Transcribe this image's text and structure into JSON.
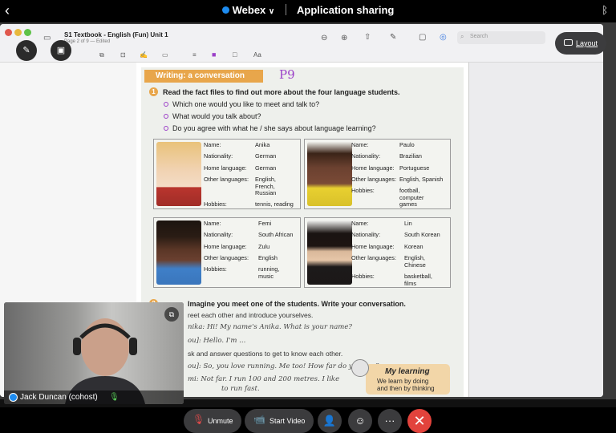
{
  "status_bar": {
    "app_name": "Webex",
    "chevron": "∨",
    "mode": "Application sharing",
    "back_glyph": "‹",
    "bluetooth_glyph": "ᛒ"
  },
  "shared_app": {
    "doc_title": "S1 Textbook - English (Fun) Unit 1",
    "doc_subtitle": "Page 2 of 9 — Edited",
    "search_placeholder": "Search",
    "layout_button": "Layout"
  },
  "textbook": {
    "banner": "Writing: a conversation",
    "handwritten_mark": "P9",
    "exercise1": {
      "number": "1",
      "instruction": "Read the fact files to find out more about the four language students.",
      "questions": [
        "Which one would you like to meet and talk to?",
        "What would you talk about?",
        "Do you agree with what he / she says about language learning?"
      ]
    },
    "labels": {
      "name": "Name:",
      "nationality": "Nationality:",
      "home_language": "Home language:",
      "other_languages": "Other languages:",
      "hobbies": "Hobbies:"
    },
    "students": [
      {
        "name": "Anika",
        "nationality": "German",
        "home_language": "German",
        "other_languages": "English,\nFrench,\nRussian",
        "hobbies": "tennis, reading"
      },
      {
        "name": "Paulo",
        "nationality": "Brazilian",
        "home_language": "Portuguese",
        "other_languages": "English, Spanish",
        "hobbies": "football,\ncomputer\ngames"
      },
      {
        "name": "Femi",
        "nationality": "South African",
        "home_language": "Zulu",
        "other_languages": "English",
        "hobbies": "running,\nmusic"
      },
      {
        "name": "Lin",
        "nationality": "South Korean",
        "home_language": "Korean",
        "other_languages": "English,\nChinese",
        "hobbies": "basketball,\nfilms"
      }
    ],
    "exercise2": {
      "number": "2",
      "instruction": "Imagine you meet one of the students. Write your conversation.",
      "step_a": "reet each other and introduce yourselves.",
      "line_a1": "nika: Hi! My name's Anika. What is your name?",
      "line_a2": "ou]:  Hello. I'm ...",
      "step_b": "sk and answer questions to get to know each other.",
      "line_b1": "ou]:  So, you love running. Me too! How far do you run?",
      "line_b2": "mi:   Not far. I run 100 and 200 metres. I like",
      "line_b3": "to run fast."
    },
    "my_learning": {
      "title": "My learning",
      "text_line1": "We learn by doing",
      "text_line2": "and then by thinking"
    }
  },
  "self_view": {
    "participant": "Jack Duncan (cohost)"
  },
  "controls": {
    "unmute": "Unmute",
    "start_video": "Start Video",
    "more_glyph": "···",
    "end_glyph": "✕"
  },
  "colors": {
    "accent_orange": "#e8a64b",
    "annotation_purple": "#9b3fc8",
    "end_red": "#e2433c",
    "webex_blue": "#1e8cf0"
  },
  "icons": [
    "back-chevron-icon",
    "webex-logo-icon",
    "bluetooth-icon",
    "annotate-pen-icon",
    "share-screen-icon",
    "zoom-out-icon",
    "zoom-in-icon",
    "share-icon",
    "pen-icon",
    "search-icon",
    "layout-icon",
    "lightbulb-icon",
    "mic-icon",
    "pip-icon",
    "mic-muted-icon",
    "video-off-icon",
    "participants-icon",
    "reactions-icon",
    "more-icon",
    "end-call-icon"
  ]
}
